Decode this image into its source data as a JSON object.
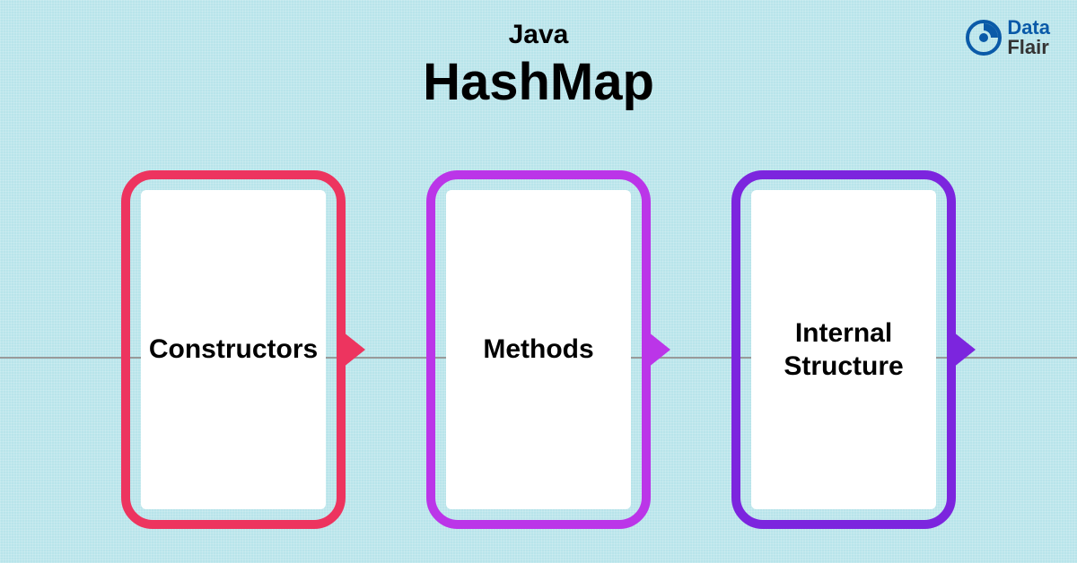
{
  "logo": {
    "data": "Data",
    "flair": "Flair"
  },
  "header": {
    "subtitle": "Java",
    "title": "HashMap"
  },
  "cards": [
    {
      "label": "Constructors",
      "color": "#ed345f"
    },
    {
      "label": "Methods",
      "color": "#bb35e8"
    },
    {
      "label": "Internal Structure",
      "color": "#7c25de"
    }
  ]
}
